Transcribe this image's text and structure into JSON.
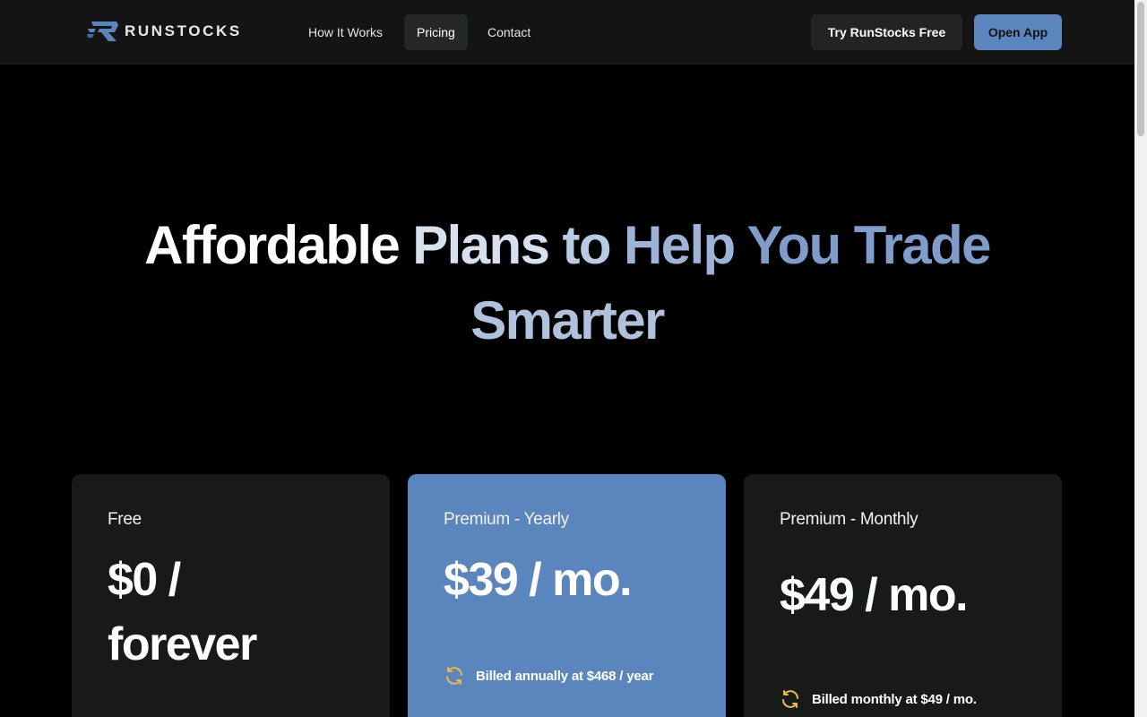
{
  "brand": {
    "name": "RUNSTOCKS",
    "accent": "#5b85bd"
  },
  "nav": {
    "links": [
      {
        "label": "How It Works"
      },
      {
        "label": "Pricing",
        "active": true
      },
      {
        "label": "Contact"
      }
    ],
    "try_button": "Try RunStocks Free",
    "open_button": "Open App"
  },
  "hero": {
    "title_words": [
      "Affordable",
      "Plans",
      "to",
      "Help",
      "You",
      "Trade",
      "Smarter"
    ]
  },
  "plans": [
    {
      "name": "Free",
      "price_line1": "$0 /",
      "price_line2": "forever"
    },
    {
      "name": "Premium - Yearly",
      "price": "$39 / mo.",
      "billing": "Billed annually at $468 / year",
      "billing_icon": "refresh-icon"
    },
    {
      "name": "Premium - Monthly",
      "price": "$49 / mo.",
      "billing": "Billed monthly at $49 / mo.",
      "billing_icon": "refresh-icon"
    }
  ],
  "colors": {
    "background": "#000000",
    "card": "#181919",
    "card_highlight": "#5b85bd",
    "icon": "#e9b84a"
  }
}
